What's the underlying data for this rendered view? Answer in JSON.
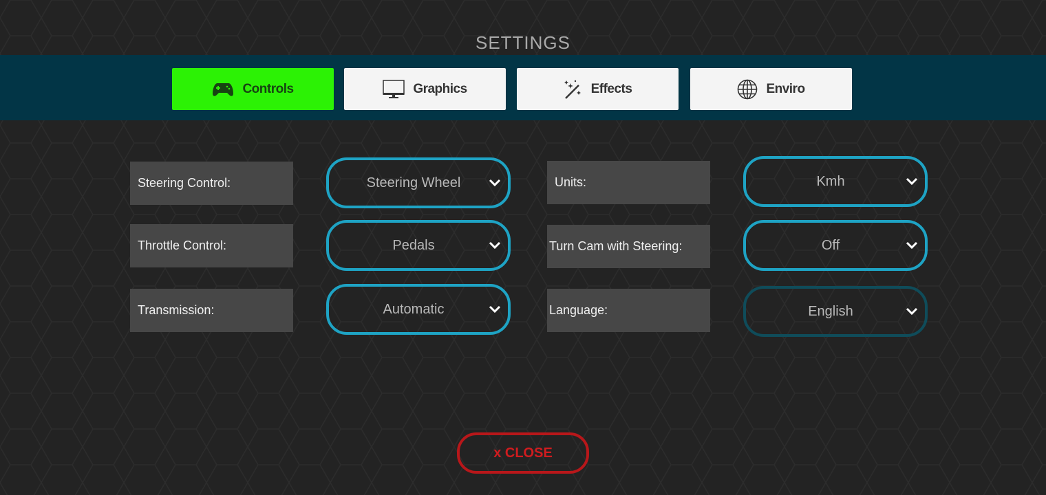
{
  "header": {
    "title": "SETTINGS"
  },
  "tabs": [
    {
      "label": "Controls",
      "icon": "gamepad-icon",
      "active": true
    },
    {
      "label": "Graphics",
      "icon": "monitor-icon",
      "active": false
    },
    {
      "label": "Effects",
      "icon": "magic-wand-icon",
      "active": false
    },
    {
      "label": "Enviro",
      "icon": "globe-icon",
      "active": false
    }
  ],
  "settings": {
    "left": [
      {
        "label": "Steering Control:",
        "value": "Steering Wheel"
      },
      {
        "label": "Throttle Control:",
        "value": "Pedals"
      },
      {
        "label": "Transmission:",
        "value": "Automatic"
      }
    ],
    "right": [
      {
        "label": "Units:",
        "value": "Kmh"
      },
      {
        "label": "Turn Cam with Steering:",
        "value": "Off"
      },
      {
        "label": "Language:",
        "value": "English"
      }
    ]
  },
  "close_button": {
    "label": "x CLOSE"
  },
  "colors": {
    "active_tab": "#2cf205",
    "tab_bar": "#023546",
    "dropdown_border": "#1ea3c4",
    "close": "#b8171a"
  }
}
